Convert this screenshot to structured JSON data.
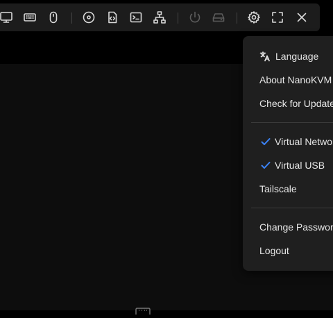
{
  "toolbar": {
    "buttons": [
      {
        "name": "monitor-icon",
        "disabled": false
      },
      {
        "name": "keyboard-icon",
        "disabled": false
      },
      {
        "name": "mouse-icon",
        "disabled": false
      },
      {
        "name": "disc-icon",
        "disabled": false
      },
      {
        "name": "script-icon",
        "disabled": false
      },
      {
        "name": "terminal-icon",
        "disabled": false
      },
      {
        "name": "network-icon",
        "disabled": false
      },
      {
        "name": "power-icon",
        "disabled": true
      },
      {
        "name": "hard-drive-icon",
        "disabled": true
      },
      {
        "name": "gear-icon",
        "disabled": false
      },
      {
        "name": "fullscreen-icon",
        "disabled": false
      },
      {
        "name": "close-icon",
        "disabled": false
      }
    ]
  },
  "settings_menu": {
    "language": "Language",
    "about": "About NanoKVM",
    "check_update": "Check for Updates",
    "virtual_network": "Virtual Network",
    "virtual_network_checked": true,
    "virtual_usb": "Virtual USB",
    "virtual_usb_checked": true,
    "tailscale": "Tailscale",
    "change_password": "Change Password",
    "logout": "Logout"
  },
  "colors": {
    "accent": "#3b82f6",
    "menu_bg": "#1f1f1f",
    "toolbar_bg": "#1c1c1c"
  }
}
